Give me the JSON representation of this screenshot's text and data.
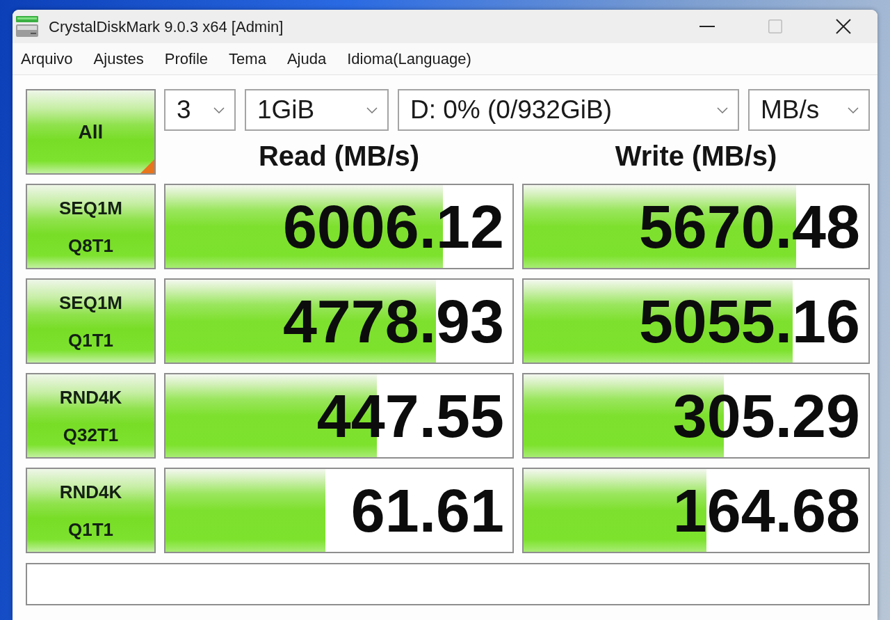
{
  "window": {
    "title": "CrystalDiskMark 9.0.3 x64 [Admin]"
  },
  "menu": [
    "Arquivo",
    "Ajustes",
    "Profile",
    "Tema",
    "Ajuda",
    "Idioma(Language)"
  ],
  "all_button": {
    "label": "All"
  },
  "selectors": [
    {
      "value": "3"
    },
    {
      "value": "1GiB"
    },
    {
      "value": "D: 0% (0/932GiB)"
    },
    {
      "value": "MB/s"
    }
  ],
  "columns": [
    "Read (MB/s)",
    "Write (MB/s)"
  ],
  "tests": [
    {
      "label": [
        "SEQ1M",
        "Q8T1"
      ],
      "read": {
        "value": "6006.12",
        "level": 0.8
      },
      "write": {
        "value": "5670.48",
        "level": 0.79
      }
    },
    {
      "label": [
        "SEQ1M",
        "Q1T1"
      ],
      "read": {
        "value": "4778.93",
        "level": 0.78
      },
      "write": {
        "value": "5055.16",
        "level": 0.78
      }
    },
    {
      "label": [
        "RND4K",
        "Q32T1"
      ],
      "read": {
        "value": "447.55",
        "level": 0.61
      },
      "write": {
        "value": "305.29",
        "level": 0.58
      }
    },
    {
      "label": [
        "RND4K",
        "Q1T1"
      ],
      "read": {
        "value": "61.61",
        "level": 0.46
      },
      "write": {
        "value": "164.68",
        "level": 0.53
      }
    }
  ]
}
